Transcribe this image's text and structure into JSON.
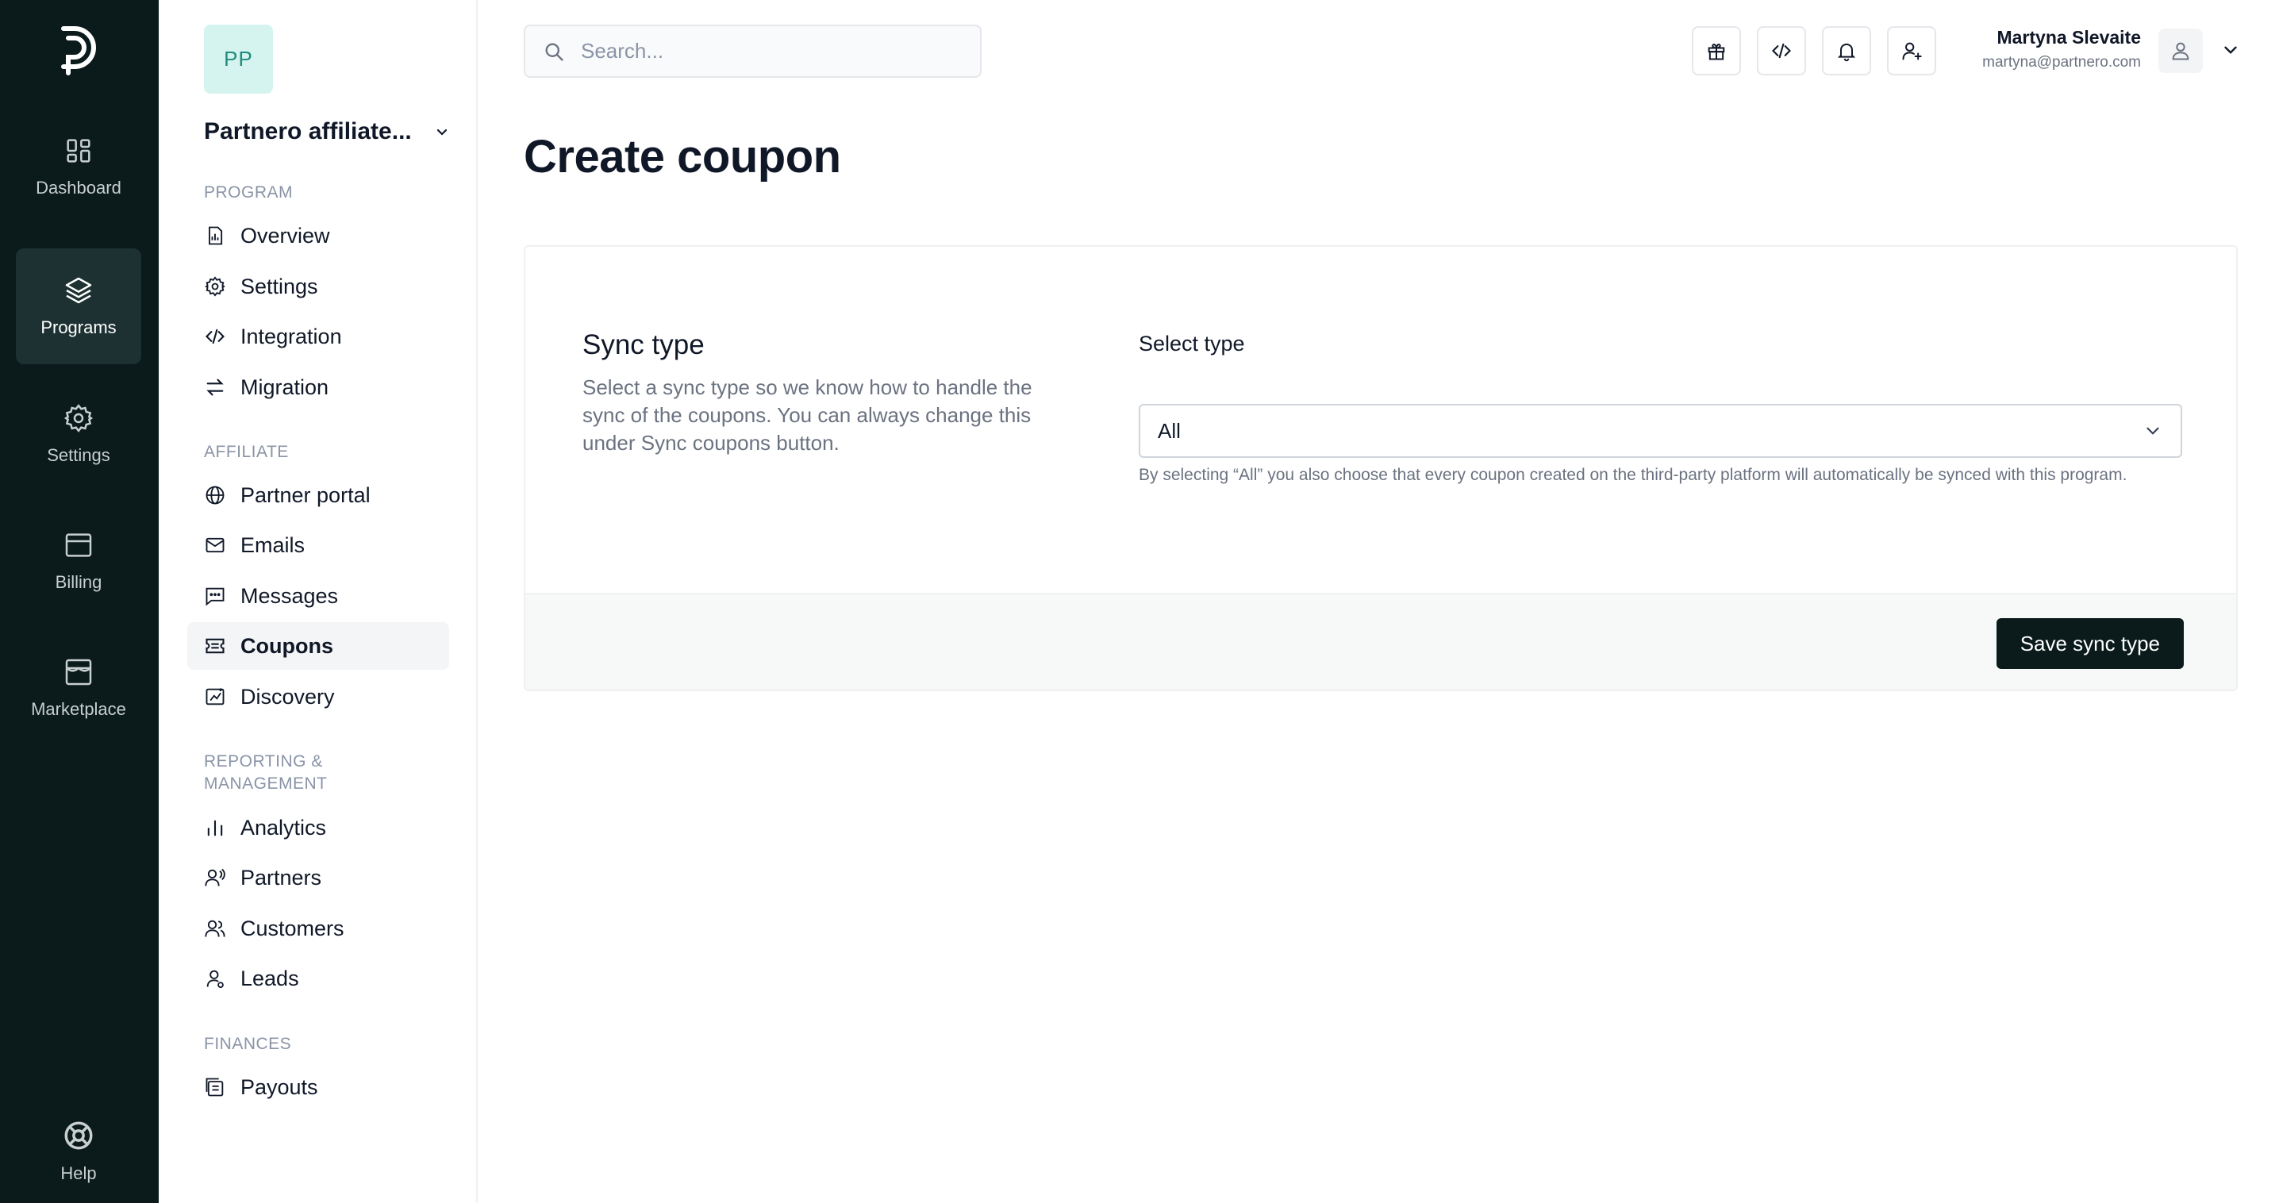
{
  "rail": {
    "items": [
      {
        "label": "Dashboard",
        "icon": "dashboard-icon"
      },
      {
        "label": "Programs",
        "icon": "layers-icon",
        "active": true
      },
      {
        "label": "Settings",
        "icon": "gear-icon"
      },
      {
        "label": "Billing",
        "icon": "billing-icon"
      },
      {
        "label": "Marketplace",
        "icon": "store-icon"
      }
    ],
    "help_label": "Help"
  },
  "sidebar": {
    "avatar_initials": "PP",
    "program_name": "Partnero affiliate...",
    "sections": {
      "program": "PROGRAM",
      "affiliate": "AFFILIATE",
      "reporting": "REPORTING &",
      "reporting_2": "MANAGEMENT",
      "finances": "FINANCES"
    },
    "items": {
      "overview": "Overview",
      "settings": "Settings",
      "integration": "Integration",
      "migration": "Migration",
      "partner_portal": "Partner portal",
      "emails": "Emails",
      "messages": "Messages",
      "coupons": "Coupons",
      "discovery": "Discovery",
      "analytics": "Analytics",
      "partners": "Partners",
      "customers": "Customers",
      "leads": "Leads",
      "payouts": "Payouts"
    },
    "active_item": "Coupons"
  },
  "header": {
    "search_placeholder": "Search...",
    "user_name": "Martyna Slevaite",
    "user_email": "martyna@partnero.com"
  },
  "main": {
    "title": "Create coupon",
    "card": {
      "title": "Sync type",
      "description": "Select a sync type so we know how to handle the sync of the coupons. You can always change this under Sync coupons button.",
      "field_label": "Select type",
      "select_value": "All",
      "help_text": "By selecting “All” you also choose that every coupon created on the third-party platform will automatically be synced with this program.",
      "save_label": "Save sync type"
    }
  },
  "colors": {
    "rail_bg": "#0b1a1a",
    "rail_active": "#1d3132",
    "accent_avatar_bg": "#d5f4ef",
    "accent_avatar_text": "#208b7e",
    "primary_button": "#0b1a1a"
  }
}
